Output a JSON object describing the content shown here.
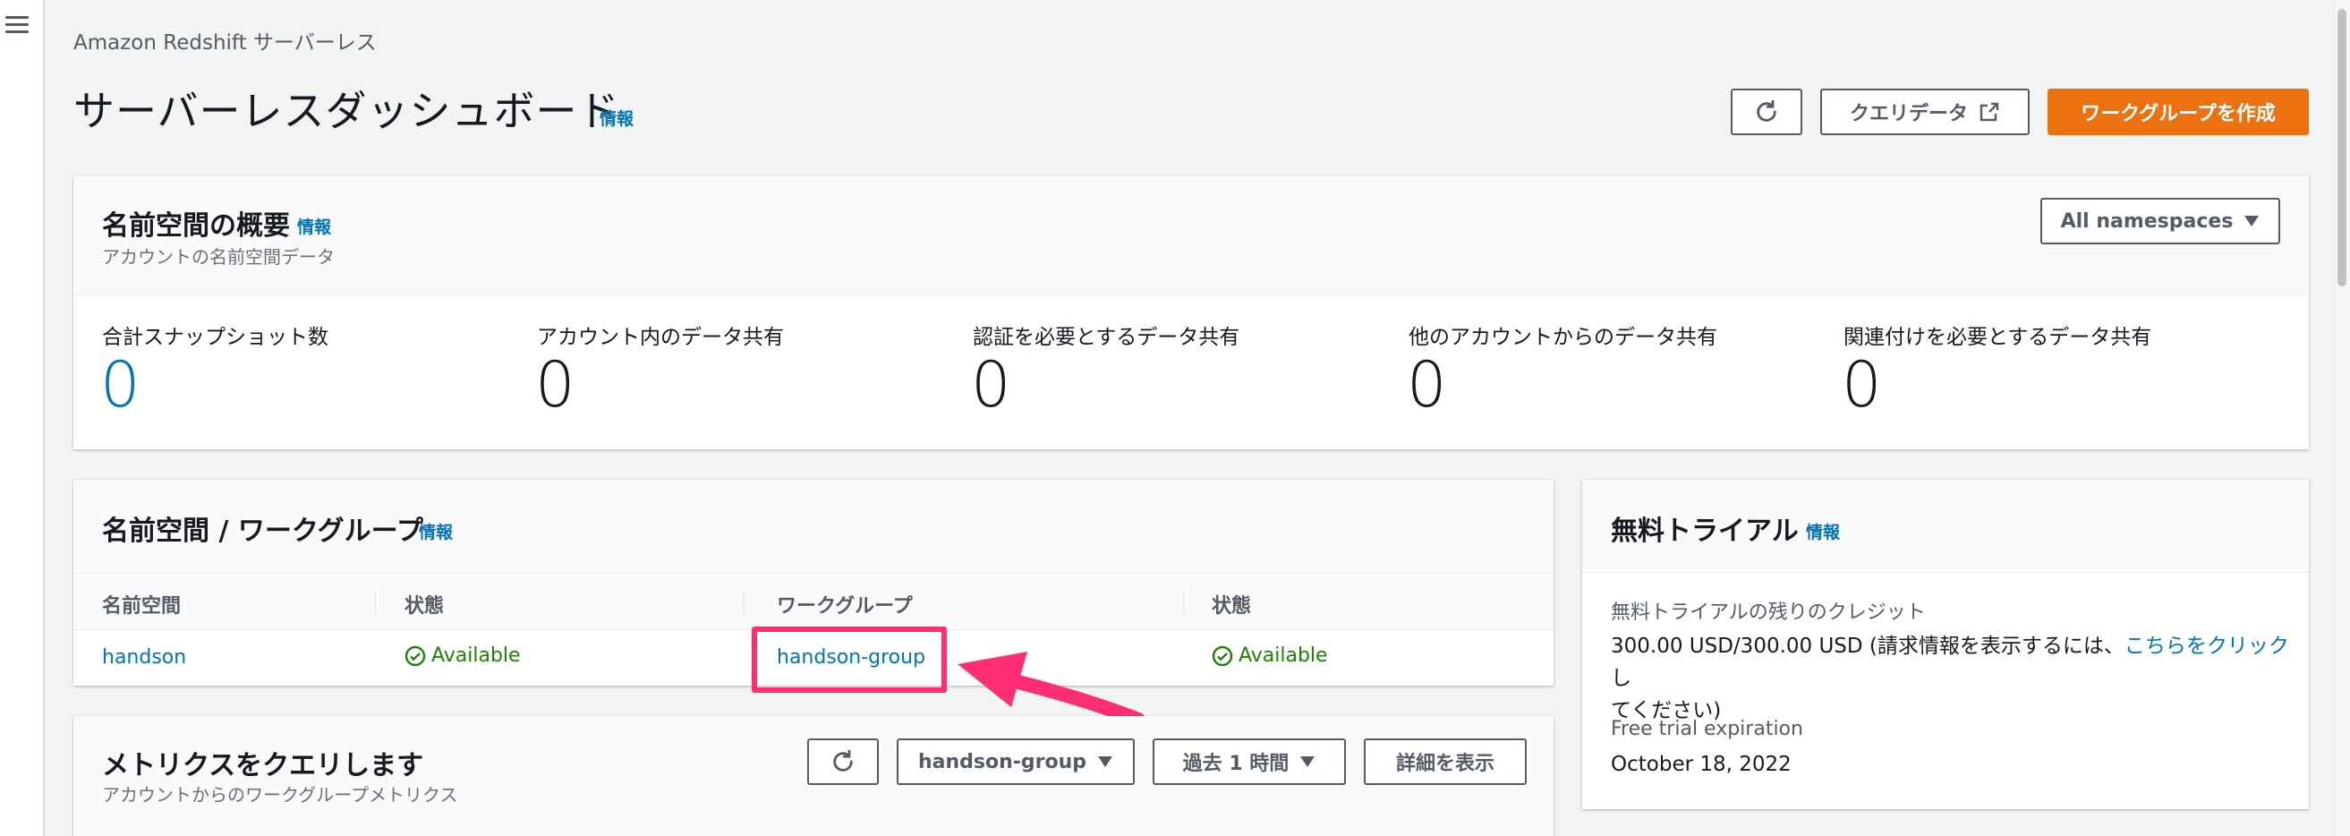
{
  "breadcrumb": "Amazon Redshift サーバーレス",
  "page": {
    "title": "サーバーレスダッシュボード",
    "info": "情報"
  },
  "header_buttons": {
    "query_data": "クエリデータ",
    "create_workgroup": "ワークグループを作成"
  },
  "namespace_overview": {
    "title": "名前空間の概要",
    "info": "情報",
    "description": "アカウントの名前空間データ",
    "filter": "All namespaces",
    "stats": [
      {
        "label": "合計スナップショット数",
        "value": "0"
      },
      {
        "label": "アカウント内のデータ共有",
        "value": "0"
      },
      {
        "label": "認証を必要とするデータ共有",
        "value": "0"
      },
      {
        "label": "他のアカウントからのデータ共有",
        "value": "0"
      },
      {
        "label": "関連付けを必要とするデータ共有",
        "value": "0"
      }
    ]
  },
  "namespace_workgroup": {
    "title": "名前空間 / ワークグループ",
    "info": "情報",
    "columns": [
      "名前空間",
      "状態",
      "ワークグループ",
      "状態"
    ],
    "rows": [
      {
        "namespace": "handson",
        "ns_status": "Available",
        "workgroup": "handson-group",
        "wg_status": "Available"
      }
    ]
  },
  "metrics": {
    "title": "メトリクスをクエリします",
    "description": "アカウントからのワークグループメトリクス",
    "workgroup_select": "handson-group",
    "time_select": "過去 1 時間",
    "details_button": "詳細を表示"
  },
  "free_trial": {
    "title": "無料トライアル",
    "info": "情報",
    "credit_label": "無料トライアルの残りのクレジット",
    "credit_text_prefix": "300.00 USD/300.00 USD (請求情報を表示するには、",
    "credit_link": "こちらをクリック",
    "credit_text_suffix_1": "し",
    "credit_text_suffix_2": "てください)",
    "expiration_label": "Free trial expiration",
    "expiration_value": "October 18, 2022"
  },
  "icons": {
    "menu": "hamburger-icon",
    "refresh": "refresh-icon",
    "external": "external-link-icon",
    "caret": "caret-down-icon",
    "check": "check-circle-icon"
  },
  "colors": {
    "primary": "#ec7211",
    "link": "#0073bb",
    "success": "#1d8102",
    "highlight": "#ff2d73"
  }
}
